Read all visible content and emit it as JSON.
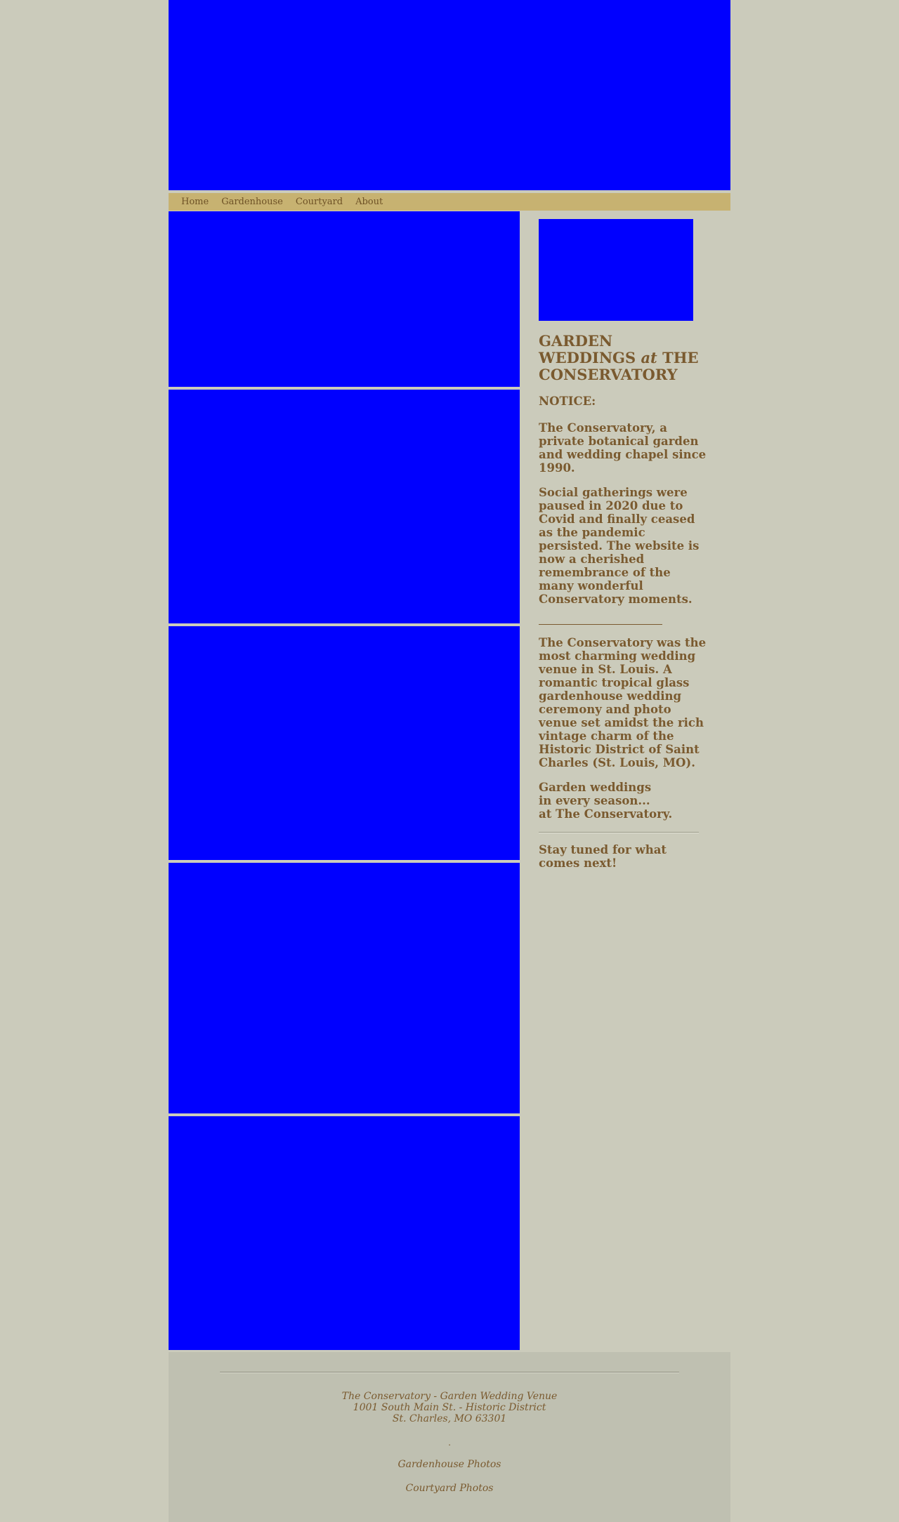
{
  "nav": {
    "items": [
      "Home",
      "Gardenhouse",
      "Courtyard",
      "About"
    ]
  },
  "sidebar": {
    "title_part1": "GARDEN WEDDINGS",
    "title_italic": "at",
    "title_part2": "THE CONSERVATORY",
    "notice": "NOTICE:",
    "para1": "The Conservatory, a private botanical garden and wedding chapel since 1990.",
    "para2": "Social gatherings were paused in 2020 due to Covid and finally ceased as the pandemic persisted. The website is now a cherished remembrance of the many wonderful Conservatory moments.",
    "para3": "The Conservatory was the most charming wedding venue in St. Louis. A romantic tropical glass gardenhouse wedding ceremony and photo venue set amidst the rich vintage charm of the Historic District of Saint Charles (St. Louis, MO).",
    "para4_line1": "Garden weddings",
    "para4_line2": "in every season...",
    "para4_line3": "at The Conservatory.",
    "para5": "Stay tuned for what comes next!"
  },
  "footer": {
    "line1": "The Conservatory - Garden Wedding Venue",
    "line2": "1001 South Main St. - Historic District",
    "line3": "St. Charles, MO 63301",
    "dot": ".",
    "link1": "Gardenhouse Photos",
    "link2": "Courtyard Photos"
  },
  "colors": {
    "background": "#cbcbbb",
    "navbar": "#c7b271",
    "footer": "#bfc0b1",
    "text": "#7a5a2f",
    "image_placeholder": "#0000ff"
  }
}
